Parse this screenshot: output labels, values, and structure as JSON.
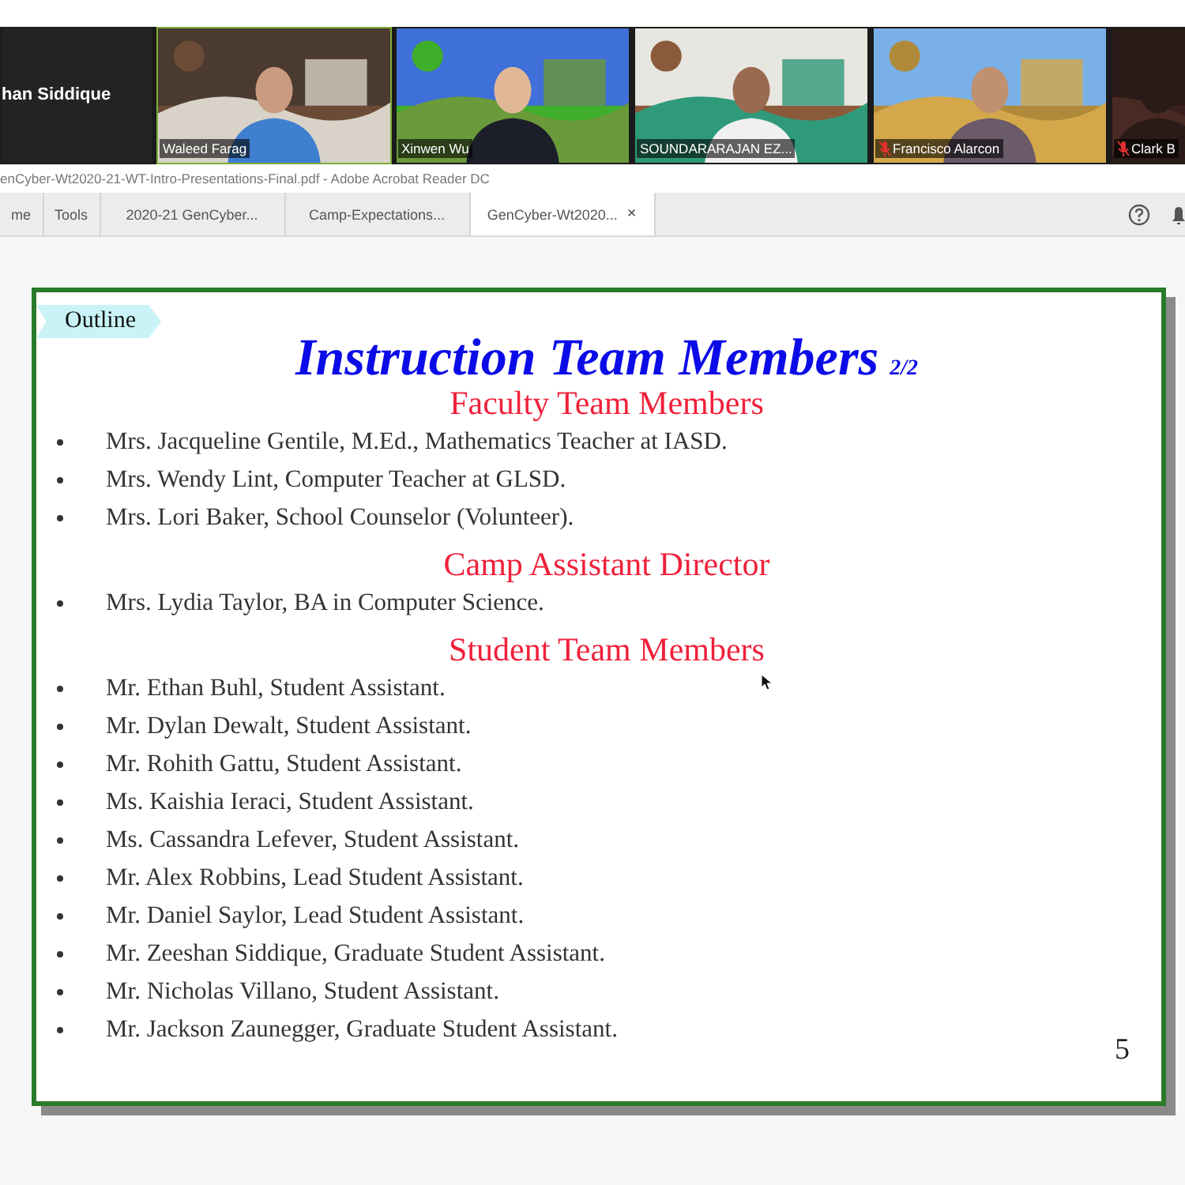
{
  "video_strip": {
    "tiles": [
      {
        "kind": "name_only",
        "name": "han Siddique",
        "active": false
      },
      {
        "kind": "video",
        "name": "Waleed Farag",
        "active": true,
        "muted": false
      },
      {
        "kind": "video",
        "name": "Xinwen Wu",
        "active": false,
        "muted": false
      },
      {
        "kind": "video",
        "name": "SOUNDARARAJAN EZ...",
        "active": false,
        "muted": false
      },
      {
        "kind": "video",
        "name": "Francisco Alarcon",
        "active": false,
        "muted": true
      },
      {
        "kind": "video",
        "name": "Clark B",
        "active": false,
        "muted": true
      }
    ]
  },
  "reader": {
    "title": "enCyber-Wt2020-21-WT-Intro-Presentations-Final.pdf - Adobe Acrobat Reader DC",
    "nav": [
      "me",
      "Tools"
    ],
    "tabs": [
      {
        "label": "2020-21 GenCyber...",
        "selected": false,
        "closable": false
      },
      {
        "label": "Camp-Expectations...",
        "selected": false,
        "closable": false
      },
      {
        "label": "GenCyber-Wt2020...",
        "selected": true,
        "closable": true
      }
    ],
    "close_glyph": "×"
  },
  "slide": {
    "outline": "Outline",
    "title": "Instruction Team Members",
    "title_suffix": "2/2",
    "sections": [
      {
        "heading": "Faculty Team Members",
        "items": [
          "Mrs. Jacqueline Gentile, M.Ed., Mathematics Teacher at IASD.",
          "Mrs. Wendy Lint, Computer Teacher at GLSD.",
          "Mrs. Lori Baker, School Counselor (Volunteer)."
        ]
      },
      {
        "heading": "Camp Assistant Director",
        "items": [
          "Mrs. Lydia Taylor, BA in Computer Science."
        ]
      },
      {
        "heading": "Student Team Members",
        "items": [
          "Mr. Ethan Buhl, Student Assistant.",
          "Mr. Dylan Dewalt, Student Assistant.",
          "Mr. Rohith Gattu, Student Assistant.",
          "Ms. Kaishia Ieraci, Student Assistant.",
          "Ms. Cassandra Lefever, Student Assistant.",
          "Mr. Alex Robbins, Lead Student Assistant.",
          "Mr. Daniel Saylor, Lead Student Assistant.",
          "Mr. Zeeshan Siddique, Graduate Student Assistant.",
          "Mr. Nicholas Villano, Student Assistant.",
          "Mr. Jackson Zaunegger, Graduate Student Assistant."
        ]
      }
    ],
    "page_number": "5"
  }
}
